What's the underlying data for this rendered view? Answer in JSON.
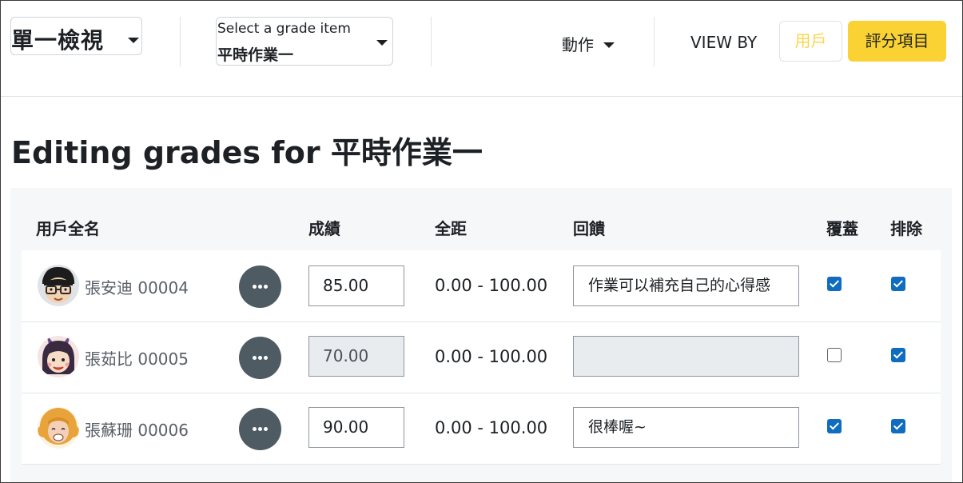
{
  "header": {
    "view_title": "單一檢視",
    "grade_select": {
      "label": "Select a grade item",
      "value": "平時作業一"
    },
    "actions_label": "動作",
    "view_by_label": "VIEW BY",
    "view_by_user": "用戶",
    "view_by_grade_item": "評分項目"
  },
  "page_title": "Editing grades for 平時作業一",
  "table": {
    "columns": [
      "用戶全名",
      "成績",
      "全距",
      "回饋",
      "覆蓋",
      "排除"
    ],
    "rows": [
      {
        "name": "張安迪 00004",
        "grade": "85.00",
        "range": "0.00 - 100.00",
        "feedback": "作業可以補充自己的心得感",
        "override": true,
        "exclude": true,
        "grade_editable": true
      },
      {
        "name": "張茹比 00005",
        "grade": "70.00",
        "range": "0.00 - 100.00",
        "feedback": "",
        "override": false,
        "exclude": true,
        "grade_editable": false
      },
      {
        "name": "張蘇珊 00006",
        "grade": "90.00",
        "range": "0.00 - 100.00",
        "feedback": "很棒喔~",
        "override": true,
        "exclude": true,
        "grade_editable": true
      }
    ]
  },
  "colors": {
    "accent": "#fbd233",
    "checkbox": "#0f6cbf",
    "menu_button": "#4e5b63"
  },
  "icons": [
    "chevron-down-icon",
    "more-actions-icon",
    "avatar-icon"
  ]
}
